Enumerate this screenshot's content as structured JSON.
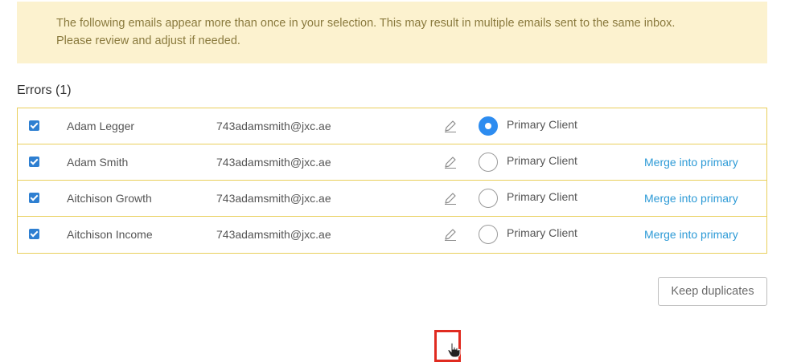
{
  "warning": {
    "line1": "The following emails appear more than once in your selection. This may result in multiple emails sent to the same inbox.",
    "line2": "Please review and adjust if needed."
  },
  "errors": {
    "heading": "Errors (1)",
    "rows": [
      {
        "name": "Adam Legger",
        "email": "743adamsmith@jxc.ae",
        "checked": true,
        "primary": true,
        "radio_label": "Primary Client",
        "merge_label": ""
      },
      {
        "name": "Adam Smith",
        "email": "743adamsmith@jxc.ae",
        "checked": true,
        "primary": false,
        "radio_label": "Primary Client",
        "merge_label": "Merge into primary"
      },
      {
        "name": "Aitchison Growth",
        "email": "743adamsmith@jxc.ae",
        "checked": true,
        "primary": false,
        "radio_label": "Primary Client",
        "merge_label": "Merge into primary"
      },
      {
        "name": "Aitchison Income",
        "email": "743adamsmith@jxc.ae",
        "checked": true,
        "primary": false,
        "radio_label": "Primary Client",
        "merge_label": "Merge into primary"
      }
    ]
  },
  "actions": {
    "keep_duplicates": "Keep duplicates"
  },
  "colors": {
    "accent": "#2d8cf0",
    "link": "#2c9ad6",
    "warning_bg": "#fcf2cf",
    "border": "#e9cf5c",
    "highlight": "#e02b20"
  }
}
